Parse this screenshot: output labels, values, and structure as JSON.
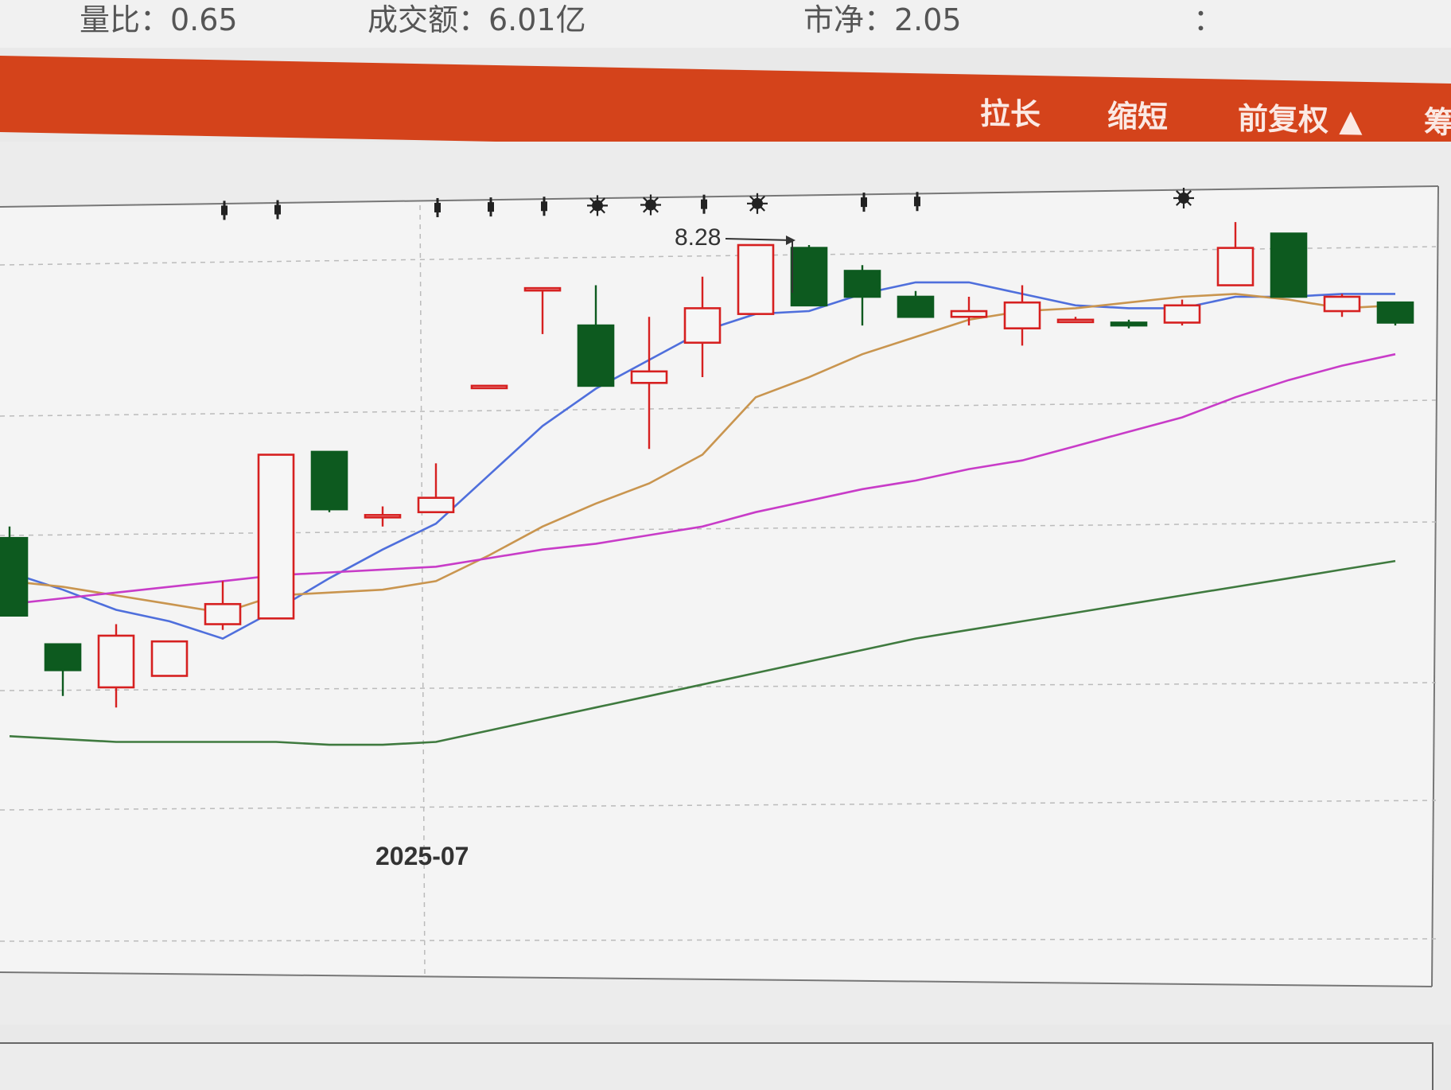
{
  "stats": {
    "volume_ratio": "量比：0.65",
    "turnover": "成交额：6.01亿",
    "cut_left": "市净：2.05",
    "cut_right": "："
  },
  "toolbar": {
    "stretch": "拉长",
    "shrink": "缩短",
    "adjust": "前复权 ▲",
    "extra": "筹"
  },
  "chart": {
    "x_label": "2025-07",
    "high_annotation": "8.28"
  },
  "chart_data": {
    "type": "candlestick",
    "x_label": "2025-07",
    "annotations": [
      {
        "text": "8.28",
        "target_index": 14
      }
    ],
    "candles": [
      {
        "i": 0,
        "open": 7.26,
        "close": 6.99,
        "high": 7.3,
        "low": 6.99
      },
      {
        "i": 1,
        "open": 6.89,
        "close": 6.8,
        "high": 6.89,
        "low": 6.71
      },
      {
        "i": 2,
        "open": 6.74,
        "close": 6.92,
        "high": 6.96,
        "low": 6.67
      },
      {
        "i": 3,
        "open": 6.78,
        "close": 6.9,
        "high": 6.9,
        "low": 6.78
      },
      {
        "i": 4,
        "open": 6.96,
        "close": 7.03,
        "high": 7.11,
        "low": 6.94
      },
      {
        "i": 5,
        "open": 6.98,
        "close": 7.55,
        "high": 7.55,
        "low": 6.98
      },
      {
        "i": 6,
        "open": 7.56,
        "close": 7.36,
        "high": 7.56,
        "low": 7.35
      },
      {
        "i": 7,
        "open": 7.34,
        "close": 7.34,
        "high": 7.37,
        "low": 7.3
      },
      {
        "i": 8,
        "open": 7.35,
        "close": 7.4,
        "high": 7.52,
        "low": 7.35
      },
      {
        "i": 9,
        "open": 7.79,
        "close": 7.79,
        "high": 7.79,
        "low": 7.79
      },
      {
        "i": 10,
        "open": 8.13,
        "close": 8.13,
        "high": 8.13,
        "low": 7.97
      },
      {
        "i": 11,
        "open": 8.0,
        "close": 7.79,
        "high": 8.14,
        "low": 7.79
      },
      {
        "i": 12,
        "open": 7.8,
        "close": 7.84,
        "high": 8.03,
        "low": 7.57
      },
      {
        "i": 13,
        "open": 7.94,
        "close": 8.06,
        "high": 8.17,
        "low": 7.82
      },
      {
        "i": 14,
        "open": 8.04,
        "close": 8.28,
        "high": 8.28,
        "low": 8.04
      },
      {
        "i": 15,
        "open": 8.27,
        "close": 8.07,
        "high": 8.28,
        "low": 8.07
      },
      {
        "i": 16,
        "open": 8.19,
        "close": 8.1,
        "high": 8.21,
        "low": 8.0
      },
      {
        "i": 17,
        "open": 8.1,
        "close": 8.03,
        "high": 8.12,
        "low": 8.03
      },
      {
        "i": 18,
        "open": 8.03,
        "close": 8.05,
        "high": 8.1,
        "low": 8.0
      },
      {
        "i": 19,
        "open": 7.99,
        "close": 8.08,
        "high": 8.14,
        "low": 7.93
      },
      {
        "i": 20,
        "open": 8.02,
        "close": 8.02,
        "high": 8.03,
        "low": 8.01
      },
      {
        "i": 21,
        "open": 8.01,
        "close": 8.0,
        "high": 8.02,
        "low": 7.99
      },
      {
        "i": 22,
        "open": 8.01,
        "close": 8.07,
        "high": 8.09,
        "low": 8.0
      },
      {
        "i": 23,
        "open": 8.14,
        "close": 8.27,
        "high": 8.36,
        "low": 8.14
      },
      {
        "i": 24,
        "open": 8.32,
        "close": 8.1,
        "high": 8.32,
        "low": 8.1
      },
      {
        "i": 25,
        "open": 8.05,
        "close": 8.1,
        "high": 8.11,
        "low": 8.03
      },
      {
        "i": 26,
        "open": 8.08,
        "close": 8.01,
        "high": 8.08,
        "low": 8.0
      }
    ],
    "series": [
      {
        "color": "#4f6fdc",
        "values": [
          7.14,
          7.08,
          7.01,
          6.97,
          6.91,
          7.01,
          7.12,
          7.22,
          7.31,
          7.48,
          7.65,
          7.78,
          7.88,
          7.98,
          8.04,
          8.05,
          8.11,
          8.15,
          8.15,
          8.11,
          8.07,
          8.06,
          8.06,
          8.1,
          8.1,
          8.11,
          8.11
        ]
      },
      {
        "color": "#c9954f",
        "values": [
          7.11,
          7.09,
          7.06,
          7.03,
          7.0,
          7.06,
          7.07,
          7.08,
          7.11,
          7.2,
          7.3,
          7.38,
          7.45,
          7.55,
          7.75,
          7.82,
          7.9,
          7.96,
          8.02,
          8.05,
          8.06,
          8.08,
          8.1,
          8.11,
          8.09,
          8.06,
          8.07
        ]
      },
      {
        "color": "#c83cc8",
        "values": [
          7.03,
          7.05,
          7.07,
          7.09,
          7.11,
          7.13,
          7.14,
          7.15,
          7.16,
          7.19,
          7.22,
          7.24,
          7.27,
          7.3,
          7.35,
          7.39,
          7.43,
          7.46,
          7.5,
          7.53,
          7.58,
          7.63,
          7.68,
          7.75,
          7.81,
          7.86,
          7.9
        ]
      },
      {
        "color": "#3f7a3f",
        "values": [
          6.57,
          6.56,
          6.55,
          6.55,
          6.55,
          6.55,
          6.54,
          6.54,
          6.55,
          6.59,
          6.63,
          6.67,
          6.71,
          6.75,
          6.79,
          6.83,
          6.87,
          6.91,
          6.94,
          6.97,
          7.0,
          7.03,
          7.06,
          7.09,
          7.12,
          7.15,
          7.18
        ]
      }
    ],
    "signals": [
      {
        "i": 4,
        "kind": "pin"
      },
      {
        "i": 5,
        "kind": "pin"
      },
      {
        "i": 8,
        "kind": "pin"
      },
      {
        "i": 9,
        "kind": "pin"
      },
      {
        "i": 10,
        "kind": "pin"
      },
      {
        "i": 11,
        "kind": "star"
      },
      {
        "i": 12,
        "kind": "star"
      },
      {
        "i": 13,
        "kind": "pin"
      },
      {
        "i": 14,
        "kind": "star"
      },
      {
        "i": 16,
        "kind": "pin"
      },
      {
        "i": 17,
        "kind": "pin"
      },
      {
        "i": 22,
        "kind": "star"
      }
    ],
    "colors": {
      "up": "#d62020",
      "down": "#0d5a1f"
    }
  }
}
